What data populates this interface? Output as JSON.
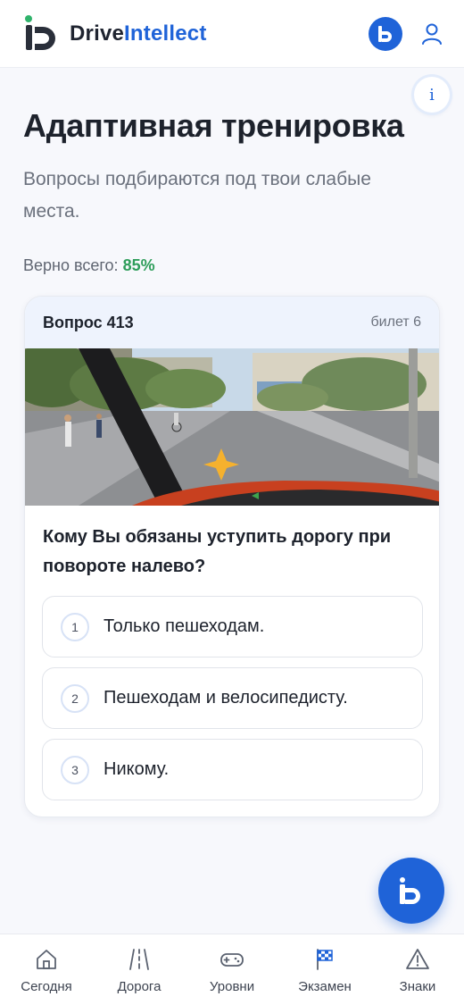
{
  "header": {
    "brand_part1": "Drive",
    "brand_part2": "Intellect",
    "badge_icon": "brand-b-icon",
    "user_icon": "user-icon"
  },
  "info_button": {
    "label": "i"
  },
  "page": {
    "title": "Адаптивная тренировка",
    "subtitle": "Вопросы подбираются под твои слабые места.",
    "score_label": "Верно всего:",
    "score_value": "85%"
  },
  "question": {
    "number_label": "Вопрос 413",
    "ticket_label": "билет 6",
    "text": "Кому Вы обязаны уступить дорогу при повороте налево?",
    "answers": [
      {
        "num": "1",
        "text": "Только пешеходам."
      },
      {
        "num": "2",
        "text": "Пешеходам и велосипедисту."
      },
      {
        "num": "3",
        "text": "Никому."
      }
    ]
  },
  "nav": {
    "items": [
      {
        "label": "Сегодня",
        "icon": "home-icon"
      },
      {
        "label": "Дорога",
        "icon": "road-icon"
      },
      {
        "label": "Уровни",
        "icon": "gamepad-icon"
      },
      {
        "label": "Экзамен",
        "icon": "checkered-flag-icon"
      },
      {
        "label": "Знаки",
        "icon": "warning-sign-icon"
      }
    ]
  },
  "colors": {
    "accent": "#1f63d8",
    "success": "#2e9d5a",
    "background": "#f7f8fc"
  }
}
